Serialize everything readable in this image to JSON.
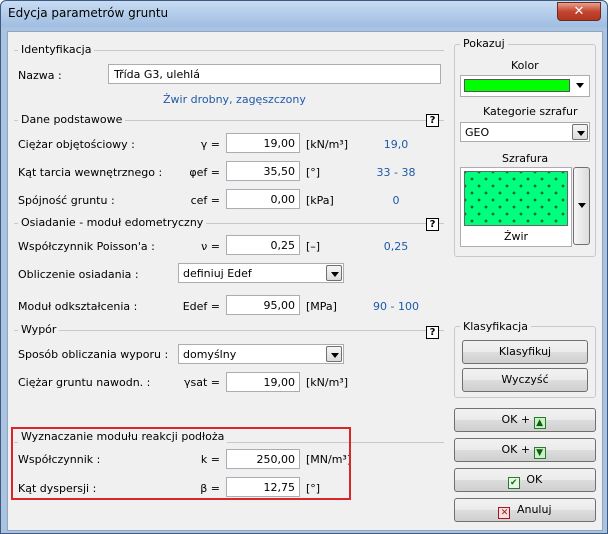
{
  "window": {
    "title": "Edycja parametrów gruntu",
    "close_label": "✕"
  },
  "identification": {
    "group_title": "Identyfikacja",
    "name_label": "Nazwa :",
    "name_value": "Třída G3, ulehlá",
    "description": "Żwir drobny, zagęszczony"
  },
  "basic": {
    "group_title": "Dane podstawowe",
    "help": "?",
    "rows": [
      {
        "label": "Ciężar objętościowy :",
        "sym": "γ =",
        "value": "19,00",
        "unit": "[kN/m³]",
        "hint": "19,0"
      },
      {
        "label": "Kąt tarcia wewnętrznego :",
        "sym": "φef =",
        "value": "35,50",
        "unit": "[°]",
        "hint": "33 - 38"
      },
      {
        "label": "Spójność gruntu :",
        "sym": "cef =",
        "value": "0,00",
        "unit": "[kPa]",
        "hint": "0"
      }
    ]
  },
  "settlement": {
    "group_title": "Osiadanie - moduł edometryczny",
    "help": "?",
    "poisson": {
      "label": "Współczynnik Poisson'a :",
      "sym": "ν =",
      "value": "0,25",
      "unit": "[–]",
      "hint": "0,25"
    },
    "calc": {
      "label": "Obliczenie osiadania :",
      "value": "definiuj Edef"
    },
    "modulus": {
      "label": "Moduł odkształcenia :",
      "sym": "Edef =",
      "value": "95,00",
      "unit": "[MPa]",
      "hint": "90 - 100"
    }
  },
  "uplift": {
    "group_title": "Wypór",
    "help": "?",
    "method": {
      "label": "Sposób obliczania wyporu :",
      "value": "domyślny"
    },
    "saturated": {
      "label": "Ciężar gruntu nawodn. :",
      "sym": "γsat =",
      "value": "19,00",
      "unit": "[kN/m³]"
    }
  },
  "subgrade": {
    "group_title": "Wyznaczanie modułu reakcji podłoża",
    "coef": {
      "label": "Współczynnik :",
      "sym": "k =",
      "value": "250,00",
      "unit": "[MN/m³]"
    },
    "angle": {
      "label": "Kąt dyspersji :",
      "sym": "β =",
      "value": "12,75",
      "unit": "[°]"
    }
  },
  "display": {
    "group_title": "Pokazuj",
    "color_label": "Kolor",
    "color_value": "#00ff00",
    "hatch_category_label": "Kategorie szrafur",
    "hatch_category_value": "GEO",
    "hatch_label": "Szrafura",
    "hatch_name": "Żwir"
  },
  "classification": {
    "group_title": "Klasyfikacja",
    "classify_button": "Klasyfikuj",
    "clear_button": "Wyczyść"
  },
  "actions": {
    "ok_plus_up": "OK +",
    "ok_plus_down": "OK +",
    "ok": "OK",
    "cancel": "Anuluj"
  }
}
